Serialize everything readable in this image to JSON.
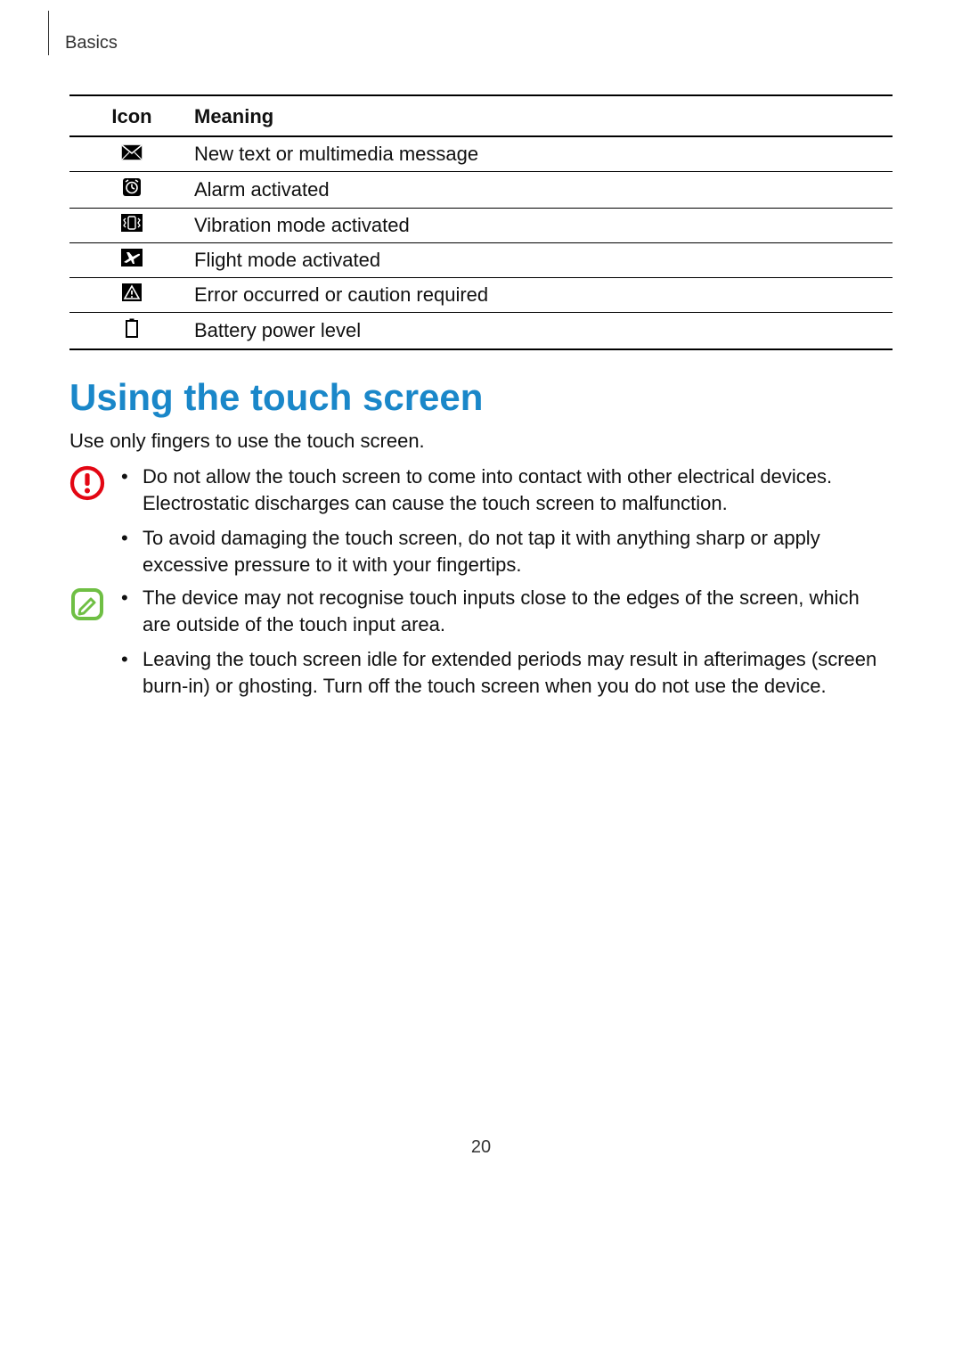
{
  "header": {
    "breadcrumb": "Basics"
  },
  "table": {
    "head_icon": "Icon",
    "head_meaning": "Meaning",
    "rows": [
      {
        "icon": "message-icon",
        "meaning": "New text or multimedia message"
      },
      {
        "icon": "alarm-icon",
        "meaning": "Alarm activated"
      },
      {
        "icon": "vibrate-icon",
        "meaning": "Vibration mode activated"
      },
      {
        "icon": "flight-icon",
        "meaning": "Flight mode activated"
      },
      {
        "icon": "warning-icon",
        "meaning": "Error occurred or caution required"
      },
      {
        "icon": "battery-icon",
        "meaning": "Battery power level"
      }
    ]
  },
  "section": {
    "title": "Using the touch screen",
    "lead": "Use only fingers to use the touch screen."
  },
  "caution": {
    "bullets": [
      "Do not allow the touch screen to come into contact with other electrical devices. Electrostatic discharges can cause the touch screen to malfunction.",
      "To avoid damaging the touch screen, do not tap it with anything sharp or apply excessive pressure to it with your fingertips."
    ]
  },
  "note": {
    "bullets": [
      "The device may not recognise touch inputs close to the edges of the screen, which are outside of the touch input area.",
      "Leaving the touch screen idle for extended periods may result in afterimages (screen burn-in) or ghosting. Turn off the touch screen when you do not use the device."
    ]
  },
  "page_number": "20",
  "glyphs": {
    "bullet": "•"
  }
}
